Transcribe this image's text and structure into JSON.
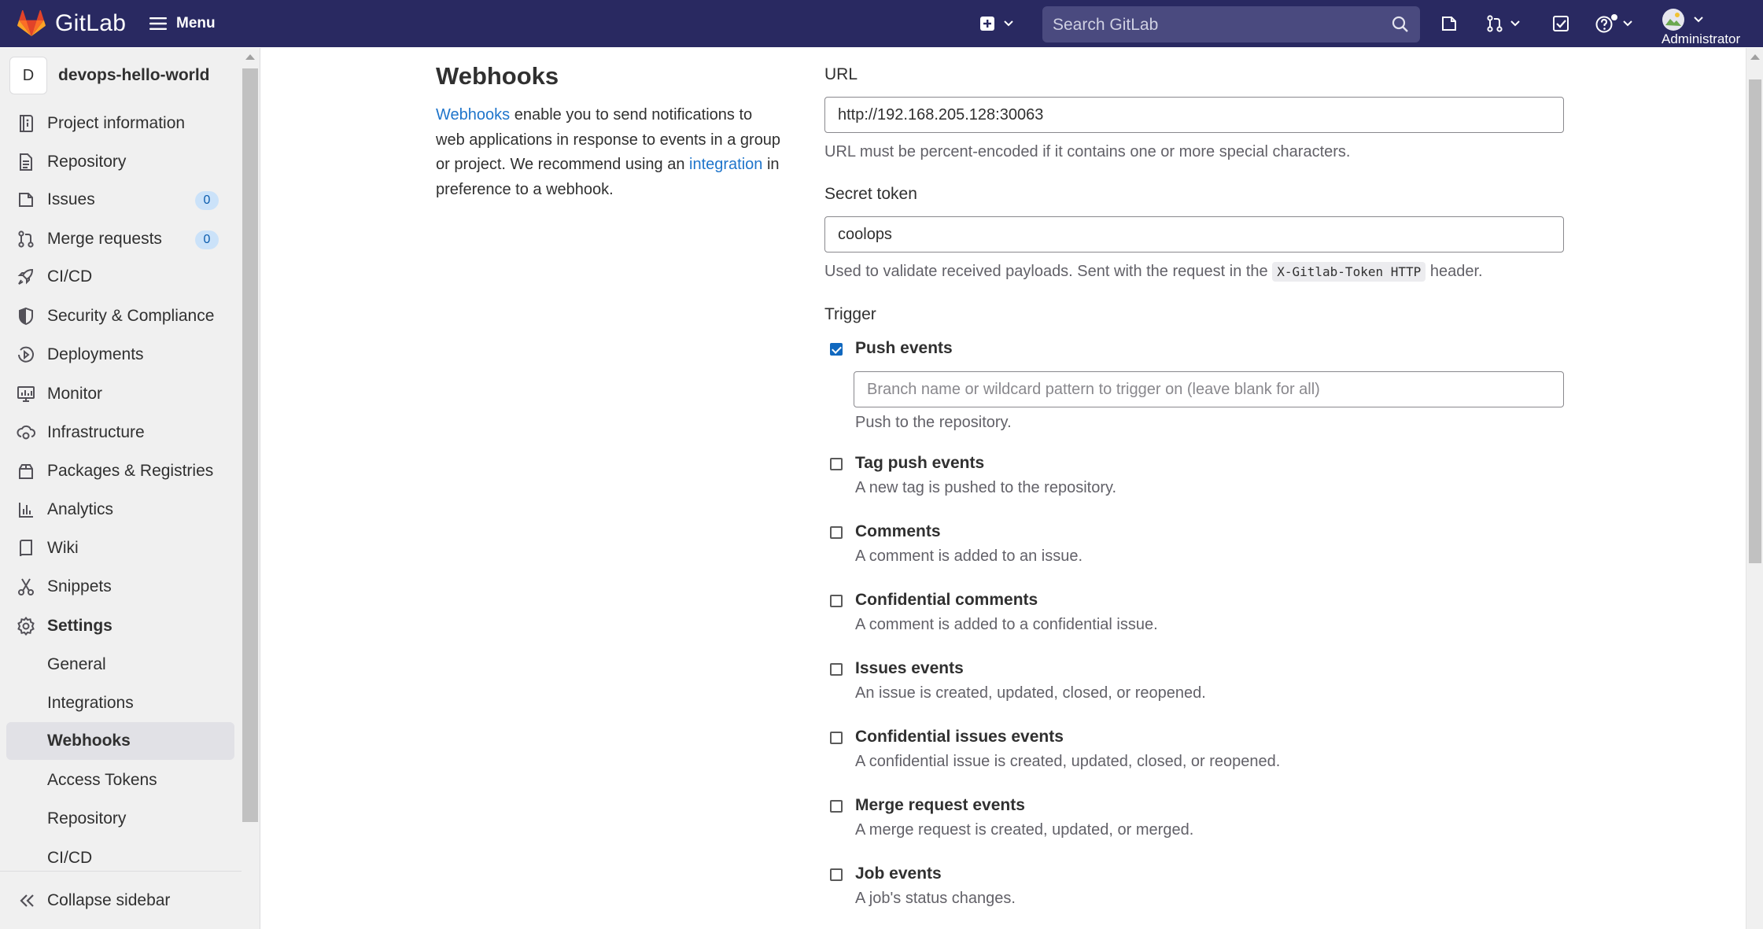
{
  "header": {
    "brand": "GitLab",
    "menu_label": "Menu",
    "search_placeholder": "Search GitLab",
    "user_label": "Administrator",
    "icons": [
      "gitlab-logo-icon",
      "hamburger-icon",
      "new-item-icon",
      "search-icon",
      "issues-icon",
      "merge-request-icon",
      "todo-icon",
      "help-icon",
      "avatar"
    ]
  },
  "sidebar": {
    "project_initial": "D",
    "project_name": "devops-hello-world",
    "items": [
      {
        "label": "Project information",
        "icon": "info-icon"
      },
      {
        "label": "Repository",
        "icon": "doc-icon"
      },
      {
        "label": "Issues",
        "icon": "issues-icon",
        "badge": "0"
      },
      {
        "label": "Merge requests",
        "icon": "merge-request-icon",
        "badge": "0"
      },
      {
        "label": "CI/CD",
        "icon": "rocket-icon"
      },
      {
        "label": "Security & Compliance",
        "icon": "shield-icon"
      },
      {
        "label": "Deployments",
        "icon": "deployments-icon"
      },
      {
        "label": "Monitor",
        "icon": "monitor-icon"
      },
      {
        "label": "Infrastructure",
        "icon": "cloud-gear-icon"
      },
      {
        "label": "Packages & Registries",
        "icon": "package-icon"
      },
      {
        "label": "Analytics",
        "icon": "chart-icon"
      },
      {
        "label": "Wiki",
        "icon": "book-icon"
      },
      {
        "label": "Snippets",
        "icon": "scissors-icon"
      },
      {
        "label": "Settings",
        "icon": "settings-icon"
      }
    ],
    "settings_sub": [
      "General",
      "Integrations",
      "Webhooks",
      "Access Tokens",
      "Repository",
      "CI/CD"
    ],
    "active_sub": "Webhooks",
    "collapse_label": "Collapse sidebar"
  },
  "main": {
    "title": "Webhooks",
    "desc": {
      "link1": "Webhooks",
      "text1": " enable you to send notifications to web applications in response to events in a group or project. We recommend using an ",
      "link2": "integration",
      "text2": " in preference to a webhook."
    },
    "url_label": "URL",
    "url_value": "http://192.168.205.128:30063",
    "url_help": "URL must be percent-encoded if it contains one or more special characters.",
    "token_label": "Secret token",
    "token_value": "coolops",
    "token_help_pre": "Used to validate received payloads. Sent with the request in the ",
    "token_help_code": "X-Gitlab-Token HTTP",
    "token_help_post": " header.",
    "trigger_label": "Trigger",
    "branch_placeholder": "Branch name or wildcard pattern to trigger on (leave blank for all)",
    "events": [
      {
        "label": "Push events",
        "help": "Push to the repository.",
        "checked": true
      },
      {
        "label": "Tag push events",
        "help": "A new tag is pushed to the repository.",
        "checked": false
      },
      {
        "label": "Comments",
        "help": "A comment is added to an issue.",
        "checked": false
      },
      {
        "label": "Confidential comments",
        "help": "A comment is added to a confidential issue.",
        "checked": false
      },
      {
        "label": "Issues events",
        "help": "An issue is created, updated, closed, or reopened.",
        "checked": false
      },
      {
        "label": "Confidential issues events",
        "help": "A confidential issue is created, updated, closed, or reopened.",
        "checked": false
      },
      {
        "label": "Merge request events",
        "help": "A merge request is created, updated, or merged.",
        "checked": false
      },
      {
        "label": "Job events",
        "help": "A job's status changes.",
        "checked": false
      }
    ]
  },
  "colors": {
    "topbar": "#292961",
    "link": "#1f75cb",
    "checkbox_on": "#1068bf",
    "sidebar_bg": "#f0f0f0"
  }
}
